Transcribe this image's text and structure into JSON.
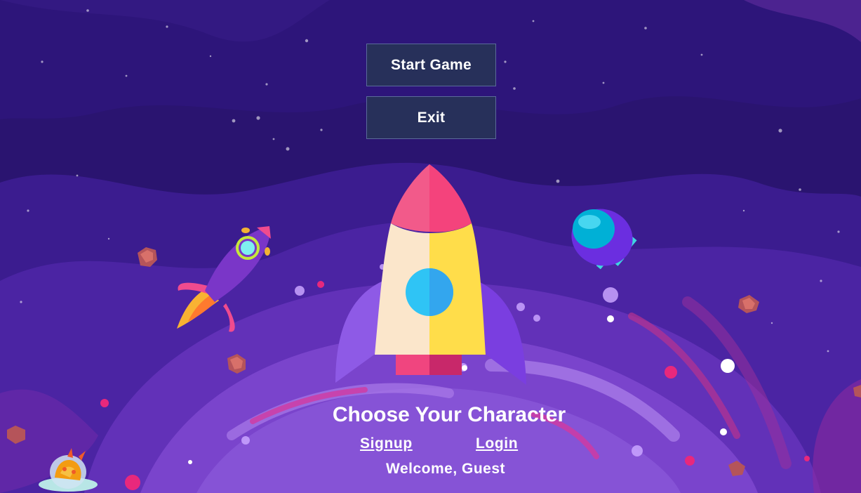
{
  "menu": {
    "start_label": "Start Game",
    "exit_label": "Exit"
  },
  "character": {
    "title": "Choose Your Character",
    "signup_label": "Signup",
    "login_label": "Login",
    "welcome_text": "Welcome, Guest"
  },
  "icons": [
    "central-rocket-icon",
    "purple-rocket-icon",
    "ufo-icon",
    "alien-saucer-icon",
    "asteroid-icon"
  ],
  "colors": {
    "background": "#2a1470",
    "button_bg": "#27305a",
    "button_border": "#5a6a9a",
    "text": "#ffffff",
    "rocket_nose": "#f25a8a",
    "rocket_body_left": "#fbe6cb",
    "rocket_body_right": "#ffdd4a",
    "rocket_window": "#2fc4f5"
  }
}
